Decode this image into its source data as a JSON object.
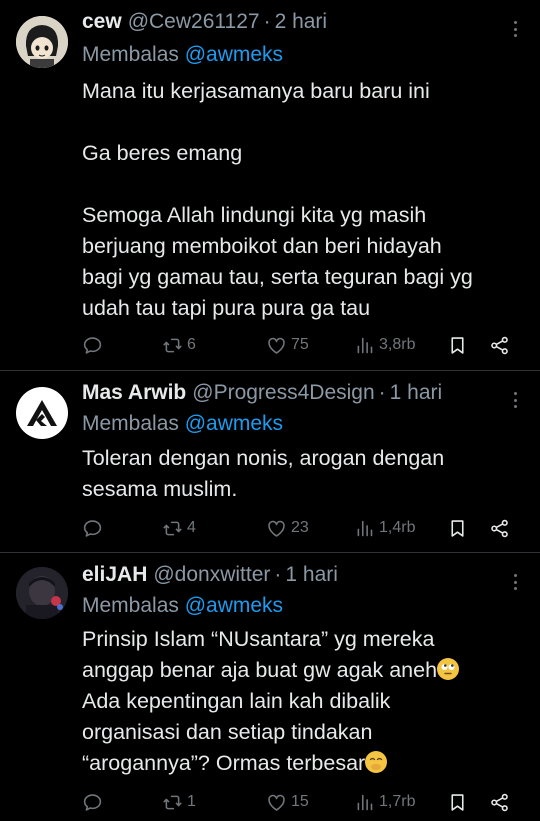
{
  "tweets": [
    {
      "name": "cew",
      "handle": "@Cew261127",
      "time": "2 hari",
      "reply_label": "Membalas",
      "reply_to": "@awmeks",
      "lines": [
        "Mana itu kerjasamanya baru baru ini",
        "",
        "Ga beres emang",
        "",
        "Semoga Allah lindungi kita yg masih",
        "berjuang memboikot dan beri hidayah",
        "bagi yg gamau tau, serta teguran bagi yg",
        "udah tau tapi pura pura ga tau"
      ],
      "retweets": "6",
      "likes": "75",
      "views": "3,8rb"
    },
    {
      "name": "Mas Arwib",
      "handle": "@Progress4Design",
      "time": "1 hari",
      "reply_label": "Membalas",
      "reply_to": "@awmeks",
      "lines": [
        "Toleran dengan nonis, arogan dengan",
        "sesama muslim."
      ],
      "retweets": "4",
      "likes": "23",
      "views": "1,4rb"
    },
    {
      "name": "eliJAH",
      "handle": "@donxwitter",
      "time": "1 hari",
      "reply_label": "Membalas",
      "reply_to": "@awmeks",
      "lines": [
        "Prinsip Islam “NUsantara” yg mereka",
        "anggap benar aja buat gw agak aneh",
        "Ada kepentingan lain kah dibalik",
        "organisasi dan setiap tindakan",
        "“arogannya”? Ormas terbesar"
      ],
      "emoji_lines": {
        "1": "face-with-rolling-eyes-emoji",
        "4": "face-with-hand-over-mouth-emoji"
      },
      "retweets": "1",
      "likes": "15",
      "views": "1,7rb"
    }
  ],
  "colors": {
    "background": "#000000",
    "text": "#e7e9ea",
    "muted": "#8b98a5",
    "link": "#1d9bf0",
    "divider": "#2f3336"
  },
  "icons": [
    "reply-icon",
    "retweet-icon",
    "like-icon",
    "views-icon",
    "bookmark-icon",
    "share-icon",
    "more-icon"
  ]
}
